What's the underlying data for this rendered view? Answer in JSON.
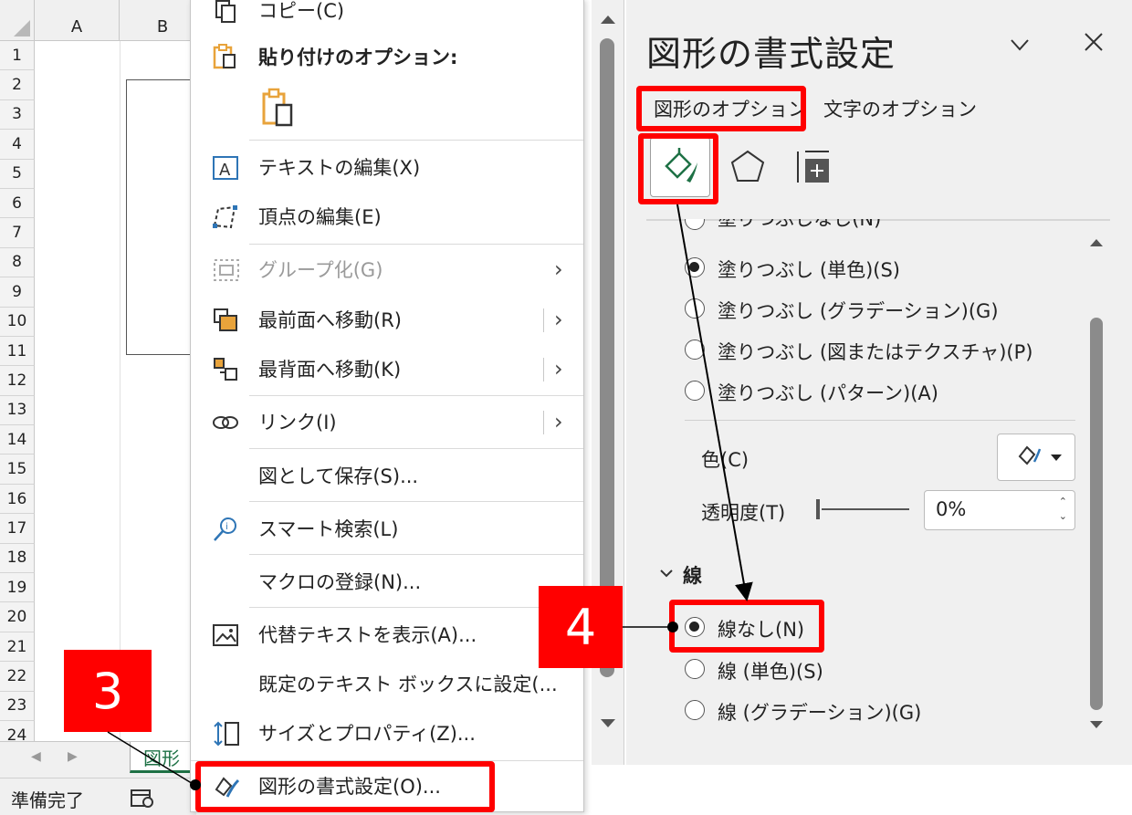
{
  "spreadsheet": {
    "columns": [
      "A",
      "B"
    ],
    "rows": [
      "1",
      "2",
      "3",
      "4",
      "5",
      "6",
      "7",
      "8",
      "9",
      "10",
      "11",
      "12",
      "13",
      "14",
      "15",
      "16",
      "17",
      "18",
      "19",
      "20",
      "21",
      "22",
      "23",
      "24"
    ],
    "sheet_tab_label": "図形",
    "tab_nav_prev": "◀",
    "tab_nav_next": "▶",
    "status_text": "準備完了"
  },
  "context_menu": {
    "items": [
      {
        "label": "コピー(C)",
        "icon": "copy-icon"
      },
      {
        "label": "貼り付けのオプション:",
        "icon": "paste-icon",
        "bold": true
      },
      {
        "label": "",
        "icon": "paste-option-icon"
      },
      {
        "label": "テキストの編集(X)",
        "icon": "edit-text-icon"
      },
      {
        "label": "頂点の編集(E)",
        "icon": "edit-points-icon"
      },
      {
        "label": "グループ化(G)",
        "icon": "group-icon",
        "disabled": true,
        "submenu": true
      },
      {
        "label": "最前面へ移動(R)",
        "icon": "bring-to-front-icon",
        "submenu": true
      },
      {
        "label": "最背面へ移動(K)",
        "icon": "send-to-back-icon",
        "submenu": true
      },
      {
        "label": "リンク(I)",
        "icon": "link-icon",
        "submenu": true
      },
      {
        "label": "図として保存(S)...",
        "icon": ""
      },
      {
        "label": "スマート検索(L)",
        "icon": "smart-lookup-icon"
      },
      {
        "label": "マクロの登録(N)...",
        "icon": ""
      },
      {
        "label": "代替テキストを表示(A)...",
        "icon": "alt-text-icon"
      },
      {
        "label": "既定のテキスト ボックスに設定(...",
        "icon": ""
      },
      {
        "label": "サイズとプロパティ(Z)...",
        "icon": "size-properties-icon"
      },
      {
        "label": "図形の書式設定(O)...",
        "icon": "format-shape-icon"
      }
    ],
    "submenu_glyph": "›"
  },
  "format_pane": {
    "title": "図形の書式設定",
    "tabs": [
      "図形のオプション",
      "文字のオプション"
    ],
    "icon_tabs": [
      "fill-line-icon",
      "effects-icon",
      "size-properties-icon"
    ],
    "fill_options": [
      {
        "label": "塗りつぶしなし(N)",
        "selected": false
      },
      {
        "label": "塗りつぶし (単色)(S)",
        "selected": true
      },
      {
        "label": "塗りつぶし (グラデーション)(G)",
        "selected": false
      },
      {
        "label": "塗りつぶし (図またはテクスチャ)(P)",
        "selected": false
      },
      {
        "label": "塗りつぶし (パターン)(A)",
        "selected": false
      }
    ],
    "color_label": "色(C)",
    "transparency_label": "透明度(T)",
    "transparency_value": "0%",
    "line_section_label": "線",
    "line_options": [
      {
        "label": "線なし(N)",
        "selected": true
      },
      {
        "label": "線 (単色)(S)",
        "selected": false
      },
      {
        "label": "線 (グラデーション)(G)",
        "selected": false
      }
    ]
  },
  "annotations": {
    "step3": "3",
    "step4": "4"
  },
  "colors": {
    "highlight_red": "#ff0000",
    "excel_green": "#1e7145",
    "icon_orange": "#e8a33b"
  }
}
